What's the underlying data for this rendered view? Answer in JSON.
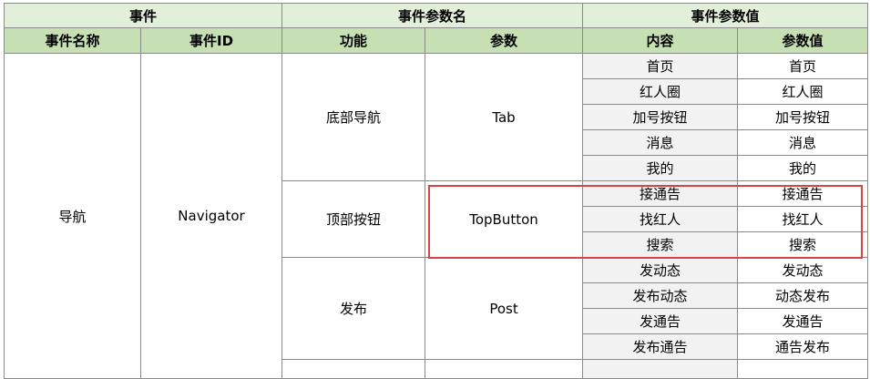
{
  "headers": {
    "top": [
      "事件",
      "事件参数名",
      "事件参数值"
    ],
    "sub": [
      "事件名称",
      "事件ID",
      "功能",
      "参数",
      "内容",
      "参数值"
    ]
  },
  "event": {
    "name": "导航",
    "id": "Navigator"
  },
  "groups": [
    {
      "function": "底部导航",
      "param": "Tab",
      "rows": [
        {
          "content": "首页",
          "value": "首页"
        },
        {
          "content": "红人圈",
          "value": "红人圈"
        },
        {
          "content": "加号按钮",
          "value": "加号按钮"
        },
        {
          "content": "消息",
          "value": "消息"
        },
        {
          "content": "我的",
          "value": "我的"
        }
      ]
    },
    {
      "function": "顶部按钮",
      "param": "TopButton",
      "highlighted": true,
      "rows": [
        {
          "content": "接通告",
          "value": "接通告"
        },
        {
          "content": "找红人",
          "value": "找红人"
        },
        {
          "content": "搜索",
          "value": "搜索"
        }
      ]
    },
    {
      "function": "发布",
      "param": "Post",
      "rows": [
        {
          "content": "发动态",
          "value": "发动态"
        },
        {
          "content": "发布动态",
          "value": "动态发布"
        },
        {
          "content": "发通告",
          "value": "发通告"
        },
        {
          "content": "发布通告",
          "value": "通告发布"
        }
      ]
    }
  ],
  "colors": {
    "header_top": "#e2efda",
    "header_sub": "#c6e0b4",
    "highlight": "#d64545",
    "content_cell": "#f2f2f2"
  }
}
